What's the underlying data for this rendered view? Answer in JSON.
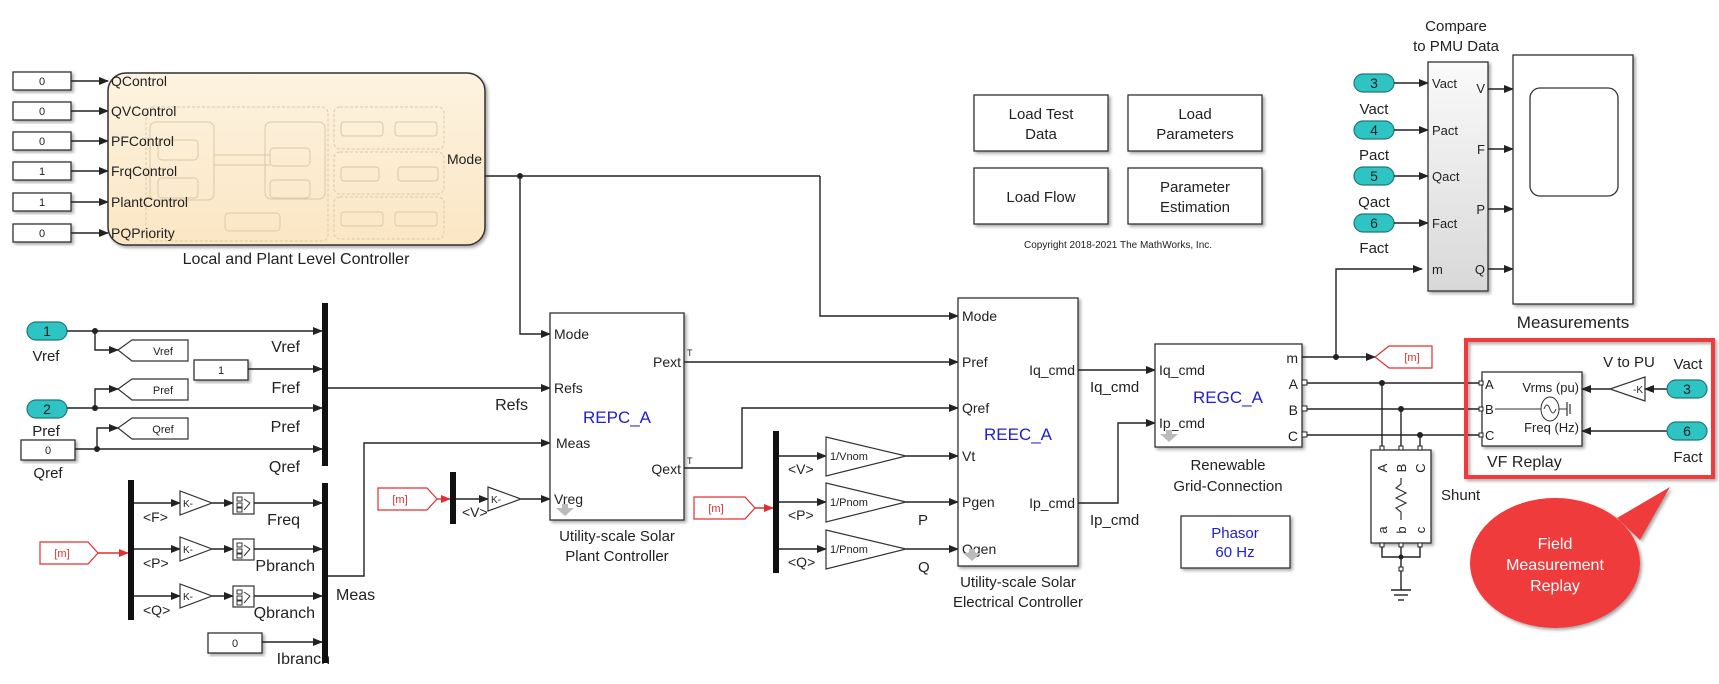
{
  "diagram": {
    "type": "simulink-model",
    "copyright": "Copyright 2018-2021 The MathWorks, Inc."
  },
  "colors": {
    "inport": "#2ec4c4",
    "goto_tag": "#e03030",
    "highlight": "#ef3b3b",
    "block_name_blue": "#2020cc",
    "chart_fill": "#fdf0d8"
  },
  "constants_left": [
    {
      "value": "0",
      "port": "QControl"
    },
    {
      "value": "0",
      "port": "QVControl"
    },
    {
      "value": "0",
      "port": "PFControl"
    },
    {
      "value": "1",
      "port": "FrqControl"
    },
    {
      "value": "1",
      "port": "PlantControl"
    },
    {
      "value": "0",
      "port": "PQPriority"
    }
  ],
  "controller_chart": {
    "label": "Local and Plant Level Controller",
    "output": "Mode"
  },
  "refs_section": {
    "inports": [
      {
        "num": "1",
        "label": "Vref"
      },
      {
        "num": "2",
        "label": "Pref"
      }
    ],
    "gotos": [
      "Vref",
      "Pref",
      "Qref"
    ],
    "fref_const": "1",
    "qref_const": "0",
    "qref_label": "Qref",
    "bus_signals": [
      "Vref",
      "Fref",
      "Pref",
      "Qref"
    ],
    "bus_label": "Refs"
  },
  "meas_section": {
    "from_tag": "[m]",
    "selectors": [
      "<F>",
      "<P>",
      "<Q>"
    ],
    "gain": "K-",
    "bus_signals": [
      "Freq",
      "Pbranch",
      "Qbranch",
      "Ibranch"
    ],
    "ibranch_const": "0",
    "bus_label": "Meas"
  },
  "repc": {
    "name": "REPC_A",
    "label_line1": "Utility-scale Solar",
    "label_line2": "Plant Controller",
    "inputs": [
      "Mode",
      "Refs",
      "Meas",
      "Vreg"
    ],
    "outputs": [
      "Pext",
      "Qext"
    ],
    "vreg_from": "[m]",
    "vreg_selector": "<V>",
    "vreg_gain": "K-"
  },
  "reec": {
    "name": "REEC_A",
    "label_line1": "Utility-scale Solar",
    "label_line2": "Electrical Controller",
    "inputs": [
      "Mode",
      "Pref",
      "Qref",
      "Vt",
      "Pgen",
      "Qgen"
    ],
    "outputs": [
      "Iq_cmd",
      "Ip_cmd"
    ],
    "from_tag": "[m]",
    "selectors": [
      "<V>",
      "<P>",
      "<Q>"
    ],
    "gains": [
      "1/Vnom",
      "1/Pnom",
      "1/Pnom"
    ],
    "signal_labels": [
      "P",
      "Q"
    ]
  },
  "regc": {
    "name": "REGC_A",
    "label_line1": "Renewable",
    "label_line2": "Grid-Connection",
    "inputs": [
      "Iq_cmd",
      "Ip_cmd"
    ],
    "outputs": [
      "m",
      "A",
      "B",
      "C"
    ],
    "wire_labels": [
      "Iq_cmd",
      "Ip_cmd"
    ],
    "goto_tag": "[m]"
  },
  "buttons": [
    {
      "line1": "Load Test",
      "line2": "Data"
    },
    {
      "line1": "Load",
      "line2": "Parameters"
    },
    {
      "line1": "Load Flow",
      "line2": ""
    },
    {
      "line1": "Parameter",
      "line2": "Estimation"
    }
  ],
  "powergui": {
    "line1": "Phasor",
    "line2": "60 Hz"
  },
  "compare": {
    "label_line1": "Compare",
    "label_line2": "to PMU Data",
    "inputs": [
      "Vact",
      "Pact",
      "Qact",
      "Fact",
      "m"
    ],
    "outputs": [
      "V",
      "F",
      "P",
      "Q"
    ],
    "inports": [
      {
        "num": "3",
        "label": "Vact"
      },
      {
        "num": "4",
        "label": "Pact"
      },
      {
        "num": "5",
        "label": "Qact"
      },
      {
        "num": "6",
        "label": "Fact"
      }
    ]
  },
  "scope": {
    "label": "Measurements"
  },
  "shunt": {
    "label": "Shunt",
    "top_ports": [
      "A",
      "B",
      "C"
    ],
    "bottom_ports": [
      "a",
      "b",
      "c"
    ]
  },
  "vf_replay": {
    "label": "VF Replay",
    "ports": [
      "A",
      "B",
      "C"
    ],
    "inputs": [
      "Vrms (pu)",
      "Freq (Hz)"
    ],
    "gain_label": "V to PU",
    "gain": "-K",
    "inports": [
      {
        "num": "3",
        "label": "Vact"
      },
      {
        "num": "6",
        "label": "Fact"
      }
    ]
  },
  "callout": {
    "line1": "Field",
    "line2": "Measurement",
    "line3": "Replay"
  }
}
